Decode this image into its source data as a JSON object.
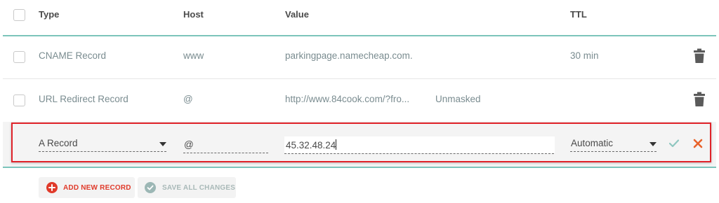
{
  "table": {
    "headers": {
      "type": "Type",
      "host": "Host",
      "value": "Value",
      "ttl": "TTL"
    },
    "rows": [
      {
        "type": "CNAME Record",
        "host": "www",
        "value": "parkingpage.namecheap.com.",
        "extra": "",
        "ttl": "30 min"
      },
      {
        "type": "URL Redirect Record",
        "host": "@",
        "value": "http://www.84cook.com/?fro...",
        "extra": "Unmasked",
        "ttl": ""
      }
    ],
    "edit_row": {
      "type": "A Record",
      "host": "@",
      "value": "45.32.48.24",
      "ttl": "Automatic"
    }
  },
  "actions": {
    "add_label": "ADD NEW RECORD",
    "save_label": "SAVE ALL CHANGES"
  },
  "colors": {
    "accent_teal": "#7cc4bb",
    "danger": "#e03a2a",
    "edit_border": "#e0232a",
    "confirm": "#8fc7c0"
  },
  "icons": {
    "trash": "trash-icon",
    "confirm": "check-icon",
    "cancel": "close-icon",
    "add": "plus-circle-icon",
    "save": "check-circle-icon"
  }
}
